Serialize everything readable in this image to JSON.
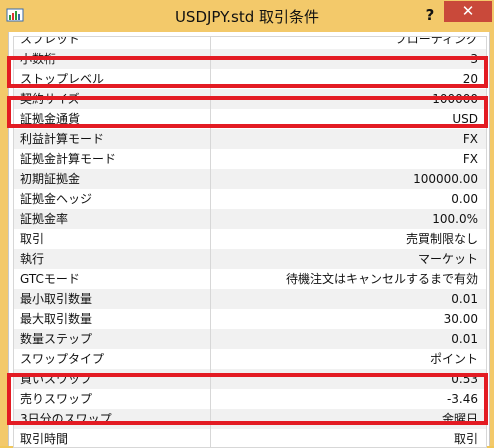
{
  "window": {
    "title": "USDJPY.std 取引条件",
    "help": "?",
    "close": "✕"
  },
  "rows_top_partial": [
    {
      "key": "スプレッド",
      "value": "フローティング"
    }
  ],
  "rows": [
    {
      "key": "小数桁",
      "value": "3"
    },
    {
      "key": "ストップレベル",
      "value": "20"
    },
    {
      "key": "契約サイズ",
      "value": "100000"
    },
    {
      "key": "証拠金通貨",
      "value": "USD"
    },
    {
      "key": "利益計算モード",
      "value": "FX"
    },
    {
      "key": "証拠金計算モード",
      "value": "FX"
    },
    {
      "key": "初期証拠金",
      "value": "100000.00"
    },
    {
      "key": "証拠金ヘッジ",
      "value": "0.00"
    },
    {
      "key": "証拠金率",
      "value": "100.0%"
    },
    {
      "key": "取引",
      "value": "売買制限なし"
    },
    {
      "key": "執行",
      "value": "マーケット"
    },
    {
      "key": "GTCモード",
      "value": "待機注文はキャンセルするまで有効"
    },
    {
      "key": "最小取引数量",
      "value": "0.01"
    },
    {
      "key": "最大取引数量",
      "value": "30.00"
    },
    {
      "key": "数量ステップ",
      "value": "0.01"
    },
    {
      "key": "スワップタイプ",
      "value": "ポイント"
    },
    {
      "key": "買いスワップ",
      "value": "0.53"
    },
    {
      "key": "売りスワップ",
      "value": "-3.46"
    },
    {
      "key": "3日分のスワップ",
      "value": "金曜日"
    }
  ],
  "rows_bottom_partial": [
    {
      "key": "取引時間",
      "value": "取引"
    }
  ],
  "colors": {
    "titlebar": "#f3c96a",
    "close_button": "#c9493a",
    "highlight": "#e31b23"
  }
}
